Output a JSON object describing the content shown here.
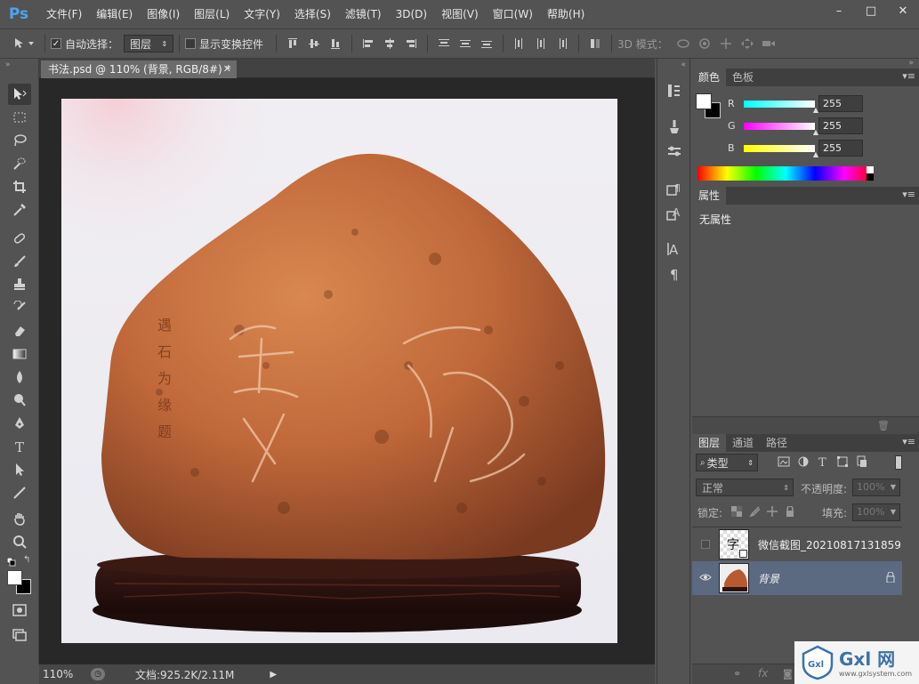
{
  "app": {
    "logo": "Ps"
  },
  "menu": [
    "文件(F)",
    "编辑(E)",
    "图像(I)",
    "图层(L)",
    "文字(Y)",
    "选择(S)",
    "滤镜(T)",
    "3D(D)",
    "视图(V)",
    "窗口(W)",
    "帮助(H)"
  ],
  "window_controls": [
    "–",
    "□",
    "✕"
  ],
  "options": {
    "auto_select_label": "自动选择：",
    "auto_select_value": "图层",
    "show_transform_label": "显示变换控件",
    "mode_3d_label": "3D 模式："
  },
  "document": {
    "tab_title": "书法.psd @ 110% (背景, RGB/8#) *",
    "zoom": "110%",
    "doc_size": "文档:925.2K/2.11M"
  },
  "color_panel": {
    "tabs": [
      "颜色",
      "色板"
    ],
    "r": {
      "label": "R",
      "value": "255"
    },
    "g": {
      "label": "G",
      "value": "255"
    },
    "b": {
      "label": "B",
      "value": "255"
    }
  },
  "properties_panel": {
    "tab": "属性",
    "empty_text": "无属性"
  },
  "layers_panel": {
    "tabs": [
      "图层",
      "通道",
      "路径"
    ],
    "filter_kind": "类型",
    "blend_mode": "正常",
    "opacity_label": "不透明度:",
    "opacity_value": "100%",
    "lock_label": "锁定:",
    "fill_label": "填充:",
    "fill_value": "100%",
    "layers": [
      {
        "name": "微信截图_20210817131859",
        "visible": false,
        "selected": false
      },
      {
        "name": "背景",
        "visible": true,
        "selected": true
      }
    ]
  },
  "watermark": {
    "brand": "Gxl 网",
    "url": "www.gxlsystem.com"
  },
  "colors": {
    "app_bg": "#535353",
    "canvas_bg": "#282828",
    "selected_layer": "#5b6981",
    "ps_blue": "#4ea3ef"
  }
}
